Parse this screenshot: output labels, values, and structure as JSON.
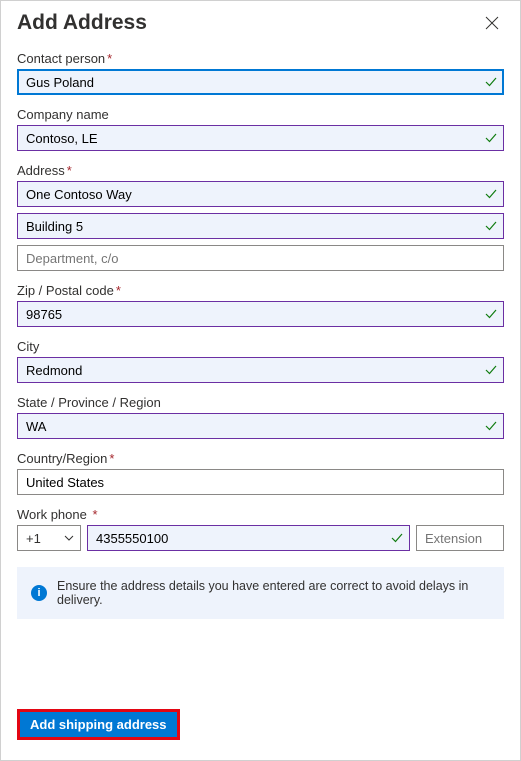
{
  "header": {
    "title": "Add Address"
  },
  "labels": {
    "contact": "Contact person",
    "company": "Company name",
    "address": "Address",
    "zip": "Zip / Postal code",
    "city": "City",
    "state": "State / Province / Region",
    "country": "Country/Region",
    "phone": "Work phone"
  },
  "values": {
    "contact": "Gus Poland",
    "company": "Contoso, LE",
    "address1": "One Contoso Way",
    "address2": "Building 5",
    "address3_placeholder": "Department, c/o",
    "zip": "98765",
    "city": "Redmond",
    "state": "WA",
    "country": "United States",
    "phone_cc": "+1",
    "phone": "4355550100",
    "ext_placeholder": "Extension"
  },
  "info": {
    "text": "Ensure the address details you have entered are correct to avoid delays in delivery."
  },
  "footer": {
    "submit": "Add shipping address"
  }
}
